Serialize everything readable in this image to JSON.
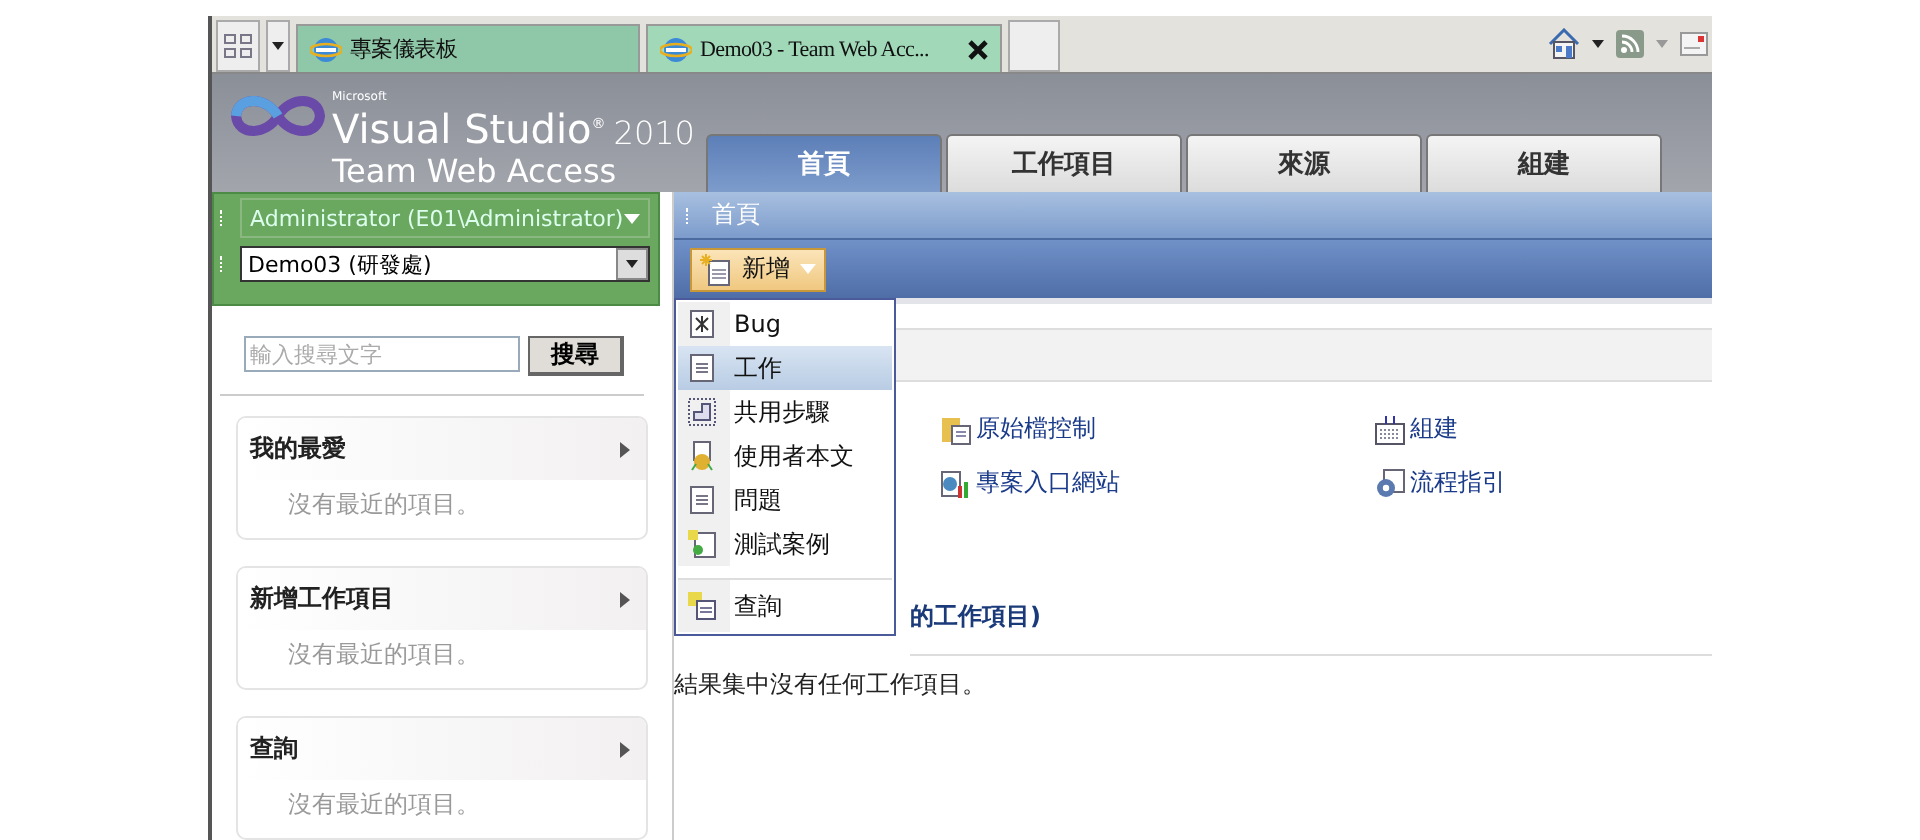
{
  "browser_tabs": [
    {
      "title": "專案儀表板",
      "selected": false
    },
    {
      "title": "Demo03 - Team Web Acc...",
      "selected": true
    }
  ],
  "header": {
    "brand_small": "Microsoft",
    "product": "Visual Studio$^{®}$",
    "year": "2010",
    "subtitle": "Team Web Access"
  },
  "nav_tabs": [
    {
      "label": "首頁",
      "selected": true
    },
    {
      "label": "工作項目",
      "selected": false
    },
    {
      "label": "來源",
      "selected": false
    },
    {
      "label": "組建",
      "selected": false
    }
  ],
  "user_menu": {
    "label": "Administrator (E01\\Administrator)"
  },
  "project_select": {
    "value": "Demo03 (研發處)"
  },
  "search": {
    "placeholder": "輸入搜尋文字",
    "button": "搜尋"
  },
  "sidebar_panels": [
    {
      "title": "我的最愛",
      "empty_text": "沒有最近的項目。"
    },
    {
      "title": "新增工作項目",
      "empty_text": "沒有最近的項目。"
    },
    {
      "title": "查詢",
      "empty_text": "沒有最近的項目。"
    }
  ],
  "breadcrumb": "首頁",
  "new_button": {
    "label": "新增"
  },
  "new_menu": [
    {
      "label": "Bug",
      "kind": "bug",
      "selected": false,
      "separated": false
    },
    {
      "label": "工作",
      "kind": "task",
      "selected": true,
      "separated": false
    },
    {
      "label": "共用步驟",
      "kind": "steps",
      "selected": false,
      "separated": false
    },
    {
      "label": "使用者本文",
      "kind": "story",
      "selected": false,
      "separated": false
    },
    {
      "label": "問題",
      "kind": "issue",
      "selected": false,
      "separated": false
    },
    {
      "label": "測試案例",
      "kind": "test",
      "selected": false,
      "separated": false
    },
    {
      "label": "查詢",
      "kind": "query",
      "selected": false,
      "separated": true
    }
  ],
  "links": [
    {
      "label": "原始檔控制",
      "kind": "source"
    },
    {
      "label": "組建",
      "kind": "build"
    },
    {
      "label": "專案入口網站",
      "kind": "portal"
    },
    {
      "label": "流程指引",
      "kind": "guidance"
    }
  ],
  "query_heading": "的工作項目)",
  "result_text": "結果集中沒有任何工作項目。"
}
